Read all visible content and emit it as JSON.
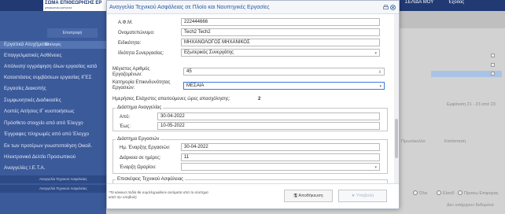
{
  "app": {
    "logo_title": "ΣΩΜΑ ΕΠΙΘΕΩΡΗΣΗΣ ΕΡ",
    "logo_subtitle": "ΕΠΙΘΕΩΡΗΣΗ ΕΡΓΑΣΙΑΣ",
    "top_links": [
      "ΣΕΛΙΔΑ ΜΟΥ",
      "Έξοδος"
    ]
  },
  "sidebar": {
    "button": "Επιστροφή",
    "header": "Επιλογές",
    "items": [
      "Εργατικά Ατυχήματα",
      "Επαγγελματικές Ασθένειες",
      "Απόλυση/ εγγράφηση όλων εργασίας κατά",
      "Καταστάσεις συμβάσεων εργασίας ΙΓΕΣ",
      "Εργασίες Διακοπής",
      "Συμφωνητικές Διαδικασίες",
      "Λοιπές Αιτήσεις ΙΓ κυοποιήσεως",
      "Πρόσθετο στοιχείο από από Έλεγχο",
      "Έγγραφες πληρωμές από από Έλεγχο",
      "Εκ των προτέρων γνωστοποίηση Οικοδ.",
      "Ηλεκτρονικό Δελτίο Προσωπικού",
      "Αναγγελίες Ι.Ε.Τ.Α."
    ],
    "subitems": [
      "Αναγγελία Τεχνικού Ασφαλείας",
      "Αναγγελία Τεχνικού Ασφαλείας"
    ]
  },
  "background": {
    "info_text": "Εμφάνιση 21 - 23 από 23",
    "col_labels": [
      "Πρωτόκολλο",
      "Κατάσταση"
    ],
    "filters": [
      "Όλα",
      "Είσοδ",
      "Προσω Επιφορας"
    ],
    "empty_text": "Δεν υπάρχουν δεδομένα"
  },
  "modal": {
    "title": "Αναγγελία Τεχνικού Ασφάλειας σε Πλοίο και Ναυπηγικές Εργασίες",
    "afm_label": "Α.Φ.Μ.",
    "afm_value": "222444666",
    "name_label": "Ονοματεπώνυμο:",
    "name_value": "Tech2 Tech2",
    "specialty_label": "Ειδικότητα:",
    "specialty_value": "ΜΗΧΑΝΟΛΟΓΟΣ ΜΗΧΑΝΙΚΟΣ",
    "cooperation_label": "Ιδιότητα Συνεργασίας:",
    "cooperation_value": "Εξωτερικός Συνεργάτης",
    "max_workers_label": "Μέγιστος Αριθμός Εργαζομένων:",
    "max_workers_value": "45",
    "danger_label": "Κατηγορία Επικινδυνότητας Εργασιών:",
    "danger_value": "ΜΕΣΑΙΑ",
    "min_hours_label": "Ημερήσιες Ελάχιστες απαιτούμενες ώρες απασχόλησης:",
    "min_hours_value": "2",
    "period_legend": "Διάστημα Αναγγελίας",
    "from_label": "Από:",
    "from_value": "30-04-2022",
    "to_label": "Έως:",
    "to_value": "10-05-2022",
    "works_legend": "Διάστημα Εργασιών",
    "start_label": "Ημ. Έναρξης Εργασιών:",
    "start_value": "30-04-2022",
    "duration_label": "Διάρκεια σε ημέρες:",
    "duration_value": "11",
    "schedule_label": "Έναρξη Ωραρίου:",
    "visits_legend": "Επισκέψεις Τεχνικού Ασφάλειας",
    "required_note": "*Τα κόκκινα πεδία θα συμπληρωθούν αυτόματα από το σύστημα κατά την υποβολή",
    "save_button": "Αποθήκευση",
    "submit_button": "Υποβολή"
  },
  "colors": {
    "topbar": "#213a73",
    "sidebar": "#3b5a9a",
    "modal_title": "#2a5aa0",
    "selected_border": "#3b7bd4"
  }
}
